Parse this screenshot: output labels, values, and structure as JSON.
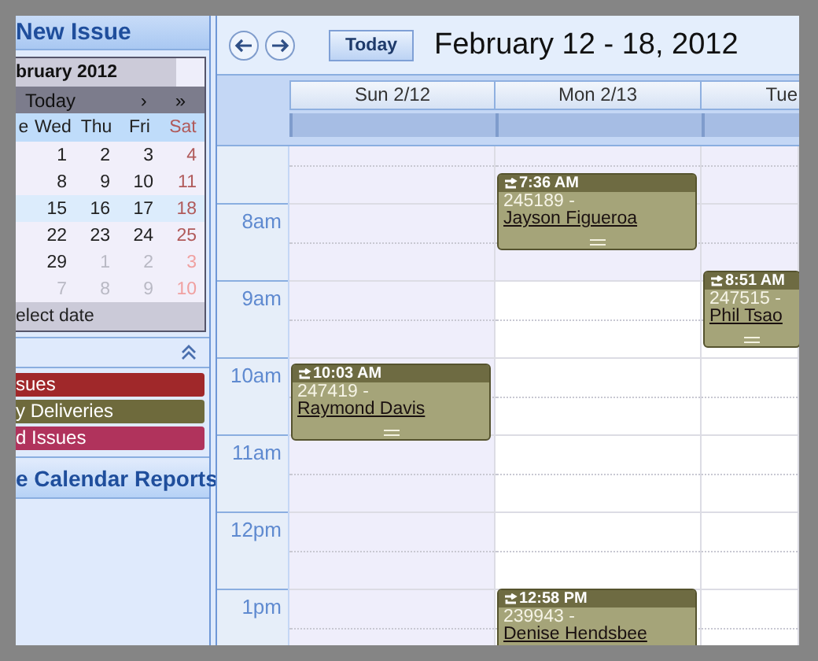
{
  "sidebar": {
    "header": "New Issue",
    "mini_calendar": {
      "title": "bruary 2012",
      "nav": [
        "Today",
        "›",
        "»"
      ],
      "weekdays": [
        {
          "label": "e",
          "weekend": false
        },
        {
          "label": "Wed",
          "weekend": false
        },
        {
          "label": "Thu",
          "weekend": false
        },
        {
          "label": "Fri",
          "weekend": false
        },
        {
          "label": "Sat",
          "weekend": true
        }
      ],
      "weeks": [
        {
          "selected": false,
          "days": [
            {
              "label": "1",
              "other_month": false
            },
            {
              "label": "2",
              "other_month": false
            },
            {
              "label": "3",
              "other_month": false
            },
            {
              "label": "4",
              "other_month": false
            }
          ]
        },
        {
          "selected": false,
          "days": [
            {
              "label": "8",
              "other_month": false
            },
            {
              "label": "9",
              "other_month": false
            },
            {
              "label": "10",
              "other_month": false
            },
            {
              "label": "11",
              "other_month": false
            }
          ]
        },
        {
          "selected": true,
          "days": [
            {
              "label": "15",
              "other_month": false
            },
            {
              "label": "16",
              "other_month": false
            },
            {
              "label": "17",
              "other_month": false
            },
            {
              "label": "18",
              "other_month": false
            }
          ]
        },
        {
          "selected": false,
          "days": [
            {
              "label": "22",
              "other_month": false
            },
            {
              "label": "23",
              "other_month": false
            },
            {
              "label": "24",
              "other_month": false
            },
            {
              "label": "25",
              "other_month": false
            }
          ]
        },
        {
          "selected": false,
          "days": [
            {
              "label": "29",
              "other_month": false
            },
            {
              "label": "1",
              "other_month": true
            },
            {
              "label": "2",
              "other_month": true
            },
            {
              "label": "3",
              "other_month": true
            }
          ]
        },
        {
          "selected": false,
          "days": [
            {
              "label": "7",
              "other_month": true
            },
            {
              "label": "8",
              "other_month": true
            },
            {
              "label": "9",
              "other_month": true
            },
            {
              "label": "10",
              "other_month": true
            }
          ]
        }
      ],
      "footer": "elect date"
    },
    "categories": [
      {
        "label": "sues",
        "color": "#a0282a"
      },
      {
        "label": "y Deliveries",
        "color": "#6e6a3c"
      },
      {
        "label": "d Issues",
        "color": "#b0335c"
      }
    ],
    "reports": "e Calendar Reports"
  },
  "toolbar": {
    "today": "Today",
    "title": "February 12 - 18, 2012"
  },
  "hours": [
    "8am",
    "9am",
    "10am",
    "11am",
    "12pm",
    "1pm"
  ],
  "days": [
    {
      "label": "Sun 2/12",
      "weekend": true,
      "events": [
        {
          "time": "10:03 AM",
          "number": "247419 -",
          "name": "Raymond Davis"
        }
      ]
    },
    {
      "label": "Mon 2/13",
      "weekend": false,
      "events": [
        {
          "time": "7:36 AM",
          "number": "245189 -",
          "name": "Jayson Figueroa"
        },
        {
          "time": "12:58 PM",
          "number": "239943 -",
          "name": "Denise Hendsbee"
        }
      ]
    },
    {
      "label": "Tue",
      "weekend": false,
      "events": [
        {
          "time": "8:51 AM",
          "number": "247515 -",
          "name": "Phil Tsao"
        }
      ]
    }
  ]
}
